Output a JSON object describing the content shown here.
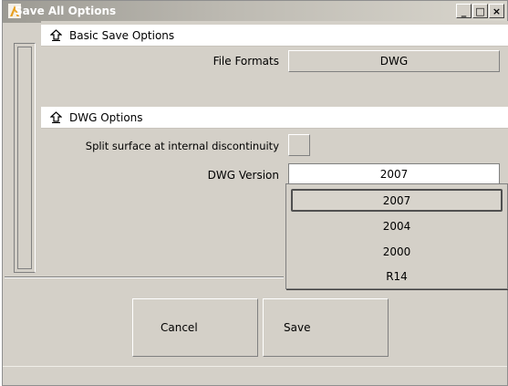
{
  "window": {
    "title": "Save All Options",
    "minimize_glyph": "_",
    "maximize_glyph": "□",
    "close_glyph": "×"
  },
  "basic_section": {
    "header": "Basic Save Options",
    "file_formats_label": "File Formats",
    "file_formats_value": "DWG"
  },
  "dwg_section": {
    "header": "DWG Options",
    "split_surface_label": "Split surface at internal discontinuity",
    "split_surface_checked": false,
    "version_label": "DWG Version",
    "version_value": "2007",
    "version_options": [
      "2007",
      "2004",
      "2000",
      "R14"
    ],
    "version_selected": "2007"
  },
  "buttons": {
    "cancel_label": "Cancel",
    "save_label": "Save"
  },
  "colors": {
    "app_icon": "#e8a020",
    "face": "#d4d0c8",
    "header_bg": "#ffffff"
  }
}
